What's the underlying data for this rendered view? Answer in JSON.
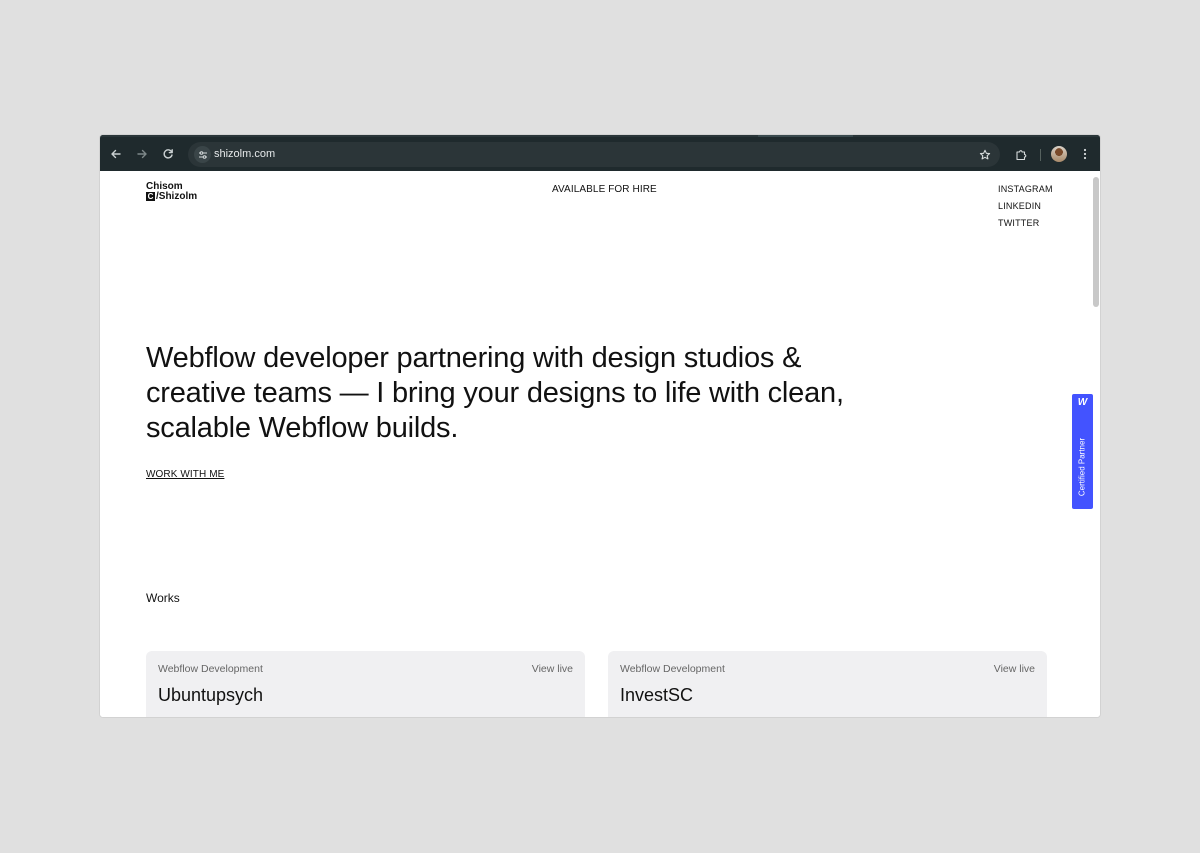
{
  "browser": {
    "url": "shizolm.com",
    "icons": {
      "back": "arrow-left-icon",
      "forward": "arrow-right-icon",
      "reload": "reload-icon",
      "site_info": "tune-icon",
      "bookmark": "star-icon",
      "extensions": "puzzle-icon",
      "menu": "kebab-menu-icon"
    }
  },
  "header": {
    "logo_line1": "Chisom",
    "logo_mark": "C",
    "logo_line2": "/Shizolm",
    "status": "AVAILABLE FOR HIRE",
    "social": [
      "INSTAGRAM",
      "LINKEDIN",
      "TWITTER"
    ]
  },
  "hero": {
    "heading": "Webflow developer partnering with design studios & creative teams — I bring your designs to life with clean, scalable Webflow builds.",
    "cta": "WORK WITH ME"
  },
  "works": {
    "title": "Works",
    "items": [
      {
        "category": "Webflow Development",
        "link": "View live",
        "name": "Ubuntupsych"
      },
      {
        "category": "Webflow Development",
        "link": "View live",
        "name": "InvestSC"
      }
    ]
  },
  "badge": {
    "logo": "W",
    "text": "Certified Partner",
    "color": "#4353ff"
  },
  "colors": {
    "toolbar": "#1f2a2d",
    "omnibox": "#2b3538",
    "background": "#e0e0e0",
    "card": "#f0f0f2"
  }
}
